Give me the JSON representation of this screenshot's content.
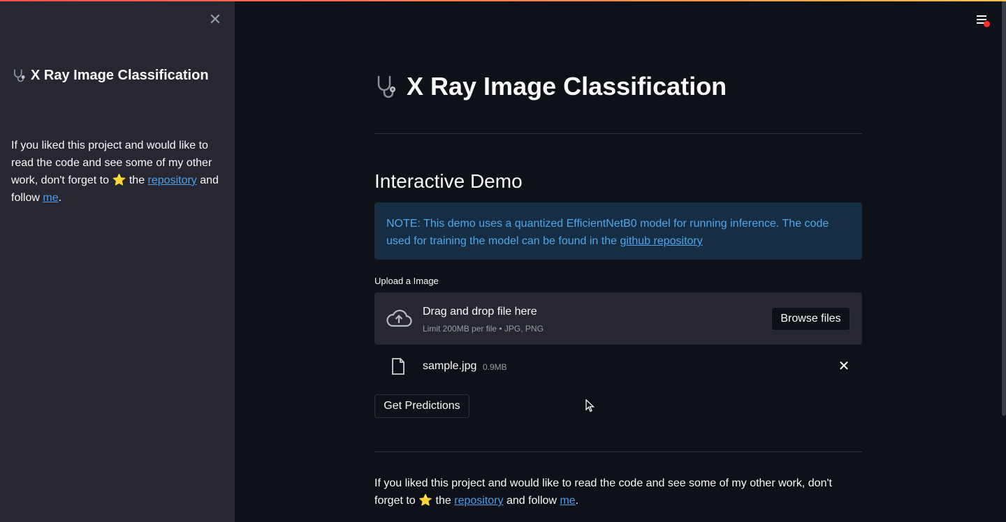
{
  "sidebar": {
    "close_icon": "close-icon",
    "title": "X Ray Image Classification",
    "text_before_star": "If you liked this project and would like to read the code and see some of my other work, don't forget to",
    "star": "⭐",
    "text_the": "the",
    "repository_link": "repository",
    "text_and_follow": "and follow",
    "me_link": "me",
    "text_end": "."
  },
  "main": {
    "menu_icon": "hamburger-menu-icon",
    "title": "X Ray Image Classification",
    "section_title": "Interactive Demo",
    "note": {
      "text": "NOTE: This demo uses a quantized EfficientNetB0 model for running inference. The code used for training the model can be found in the",
      "link": "github repository"
    },
    "uploader": {
      "label": "Upload a Image",
      "drag_text": "Drag and drop file here",
      "limit_text": "Limit 200MB per file • JPG, PNG",
      "browse_label": "Browse files",
      "file": {
        "name": "sample.jpg",
        "size": "0.9MB"
      }
    },
    "predict_label": "Get Predictions",
    "footer": {
      "text_before_star": "If you liked this project and would like to read the code and see some of my other work, don't forget to",
      "star": "⭐",
      "text_the": "the",
      "repository_link": "repository",
      "text_and_follow": "and follow",
      "me_link": "me",
      "text_end": "."
    }
  },
  "colors": {
    "background": "#0e1117",
    "sidebar": "#262730",
    "accent_link": "#4d9fec",
    "note_bg": "#172d43",
    "note_text": "#4da7ec"
  }
}
